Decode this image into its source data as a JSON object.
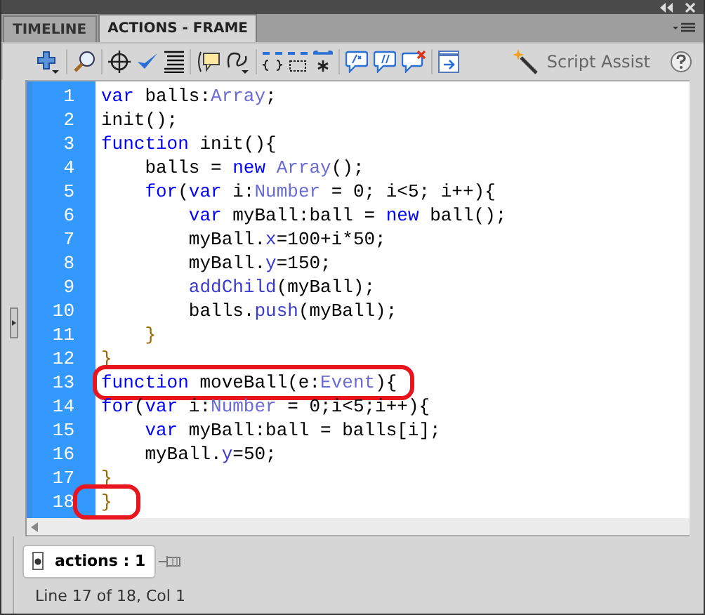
{
  "tabs": [
    {
      "label": "TIMELINE",
      "selected": false
    },
    {
      "label": "ACTIONS - FRAME",
      "selected": true
    }
  ],
  "toolbar": {
    "script_assist": "Script Assist"
  },
  "code": [
    {
      "n": "1",
      "tokens": [
        {
          "kind": "kw",
          "text": "var"
        },
        {
          "kind": "plain",
          "text": " balls:"
        },
        {
          "kind": "cls",
          "text": "Array"
        },
        {
          "kind": "plain",
          "text": ";"
        }
      ],
      "highlighted": false
    },
    {
      "n": "2",
      "tokens": [
        {
          "kind": "plain",
          "text": "init();"
        }
      ],
      "highlighted": false
    },
    {
      "n": "3",
      "tokens": [
        {
          "kind": "kw",
          "text": "function"
        },
        {
          "kind": "plain",
          "text": " init(){"
        }
      ],
      "highlighted": false
    },
    {
      "n": "4",
      "tokens": [
        {
          "kind": "plain",
          "text": "    balls = "
        },
        {
          "kind": "kw",
          "text": "new "
        },
        {
          "kind": "cls",
          "text": "Array"
        },
        {
          "kind": "plain",
          "text": "();"
        }
      ],
      "highlighted": false
    },
    {
      "n": "5",
      "tokens": [
        {
          "kind": "kw",
          "text": "    for"
        },
        {
          "kind": "plain",
          "text": "("
        },
        {
          "kind": "kw",
          "text": "var"
        },
        {
          "kind": "plain",
          "text": " i:"
        },
        {
          "kind": "cls",
          "text": "Number"
        },
        {
          "kind": "plain",
          "text": " = 0; i<5; i++){"
        }
      ],
      "highlighted": false
    },
    {
      "n": "6",
      "tokens": [
        {
          "kind": "kw",
          "text": "        var"
        },
        {
          "kind": "plain",
          "text": " myBall:ball = "
        },
        {
          "kind": "kw",
          "text": "new"
        },
        {
          "kind": "plain",
          "text": " ball();"
        }
      ],
      "highlighted": false
    },
    {
      "n": "7",
      "tokens": [
        {
          "kind": "plain",
          "text": "        myBall."
        },
        {
          "kind": "prop",
          "text": "x"
        },
        {
          "kind": "plain",
          "text": "=100+i*50;"
        }
      ],
      "highlighted": false
    },
    {
      "n": "8",
      "tokens": [
        {
          "kind": "plain",
          "text": "        myBall."
        },
        {
          "kind": "prop",
          "text": "y"
        },
        {
          "kind": "plain",
          "text": "=150;"
        }
      ],
      "highlighted": false
    },
    {
      "n": "9",
      "tokens": [
        {
          "kind": "prop",
          "text": "        addChild"
        },
        {
          "kind": "plain",
          "text": "(myBall);"
        }
      ],
      "highlighted": false
    },
    {
      "n": "10",
      "tokens": [
        {
          "kind": "plain",
          "text": "        balls."
        },
        {
          "kind": "prop",
          "text": "push"
        },
        {
          "kind": "plain",
          "text": "(myBall);"
        }
      ],
      "highlighted": false
    },
    {
      "n": "11",
      "tokens": [
        {
          "kind": "brace",
          "text": "    }"
        }
      ],
      "highlighted": false
    },
    {
      "n": "12",
      "tokens": [
        {
          "kind": "brace",
          "text": "}"
        }
      ],
      "highlighted": false
    },
    {
      "n": "13",
      "tokens": [
        {
          "kind": "kw",
          "text": "function"
        },
        {
          "kind": "plain",
          "text": " moveBall(e:"
        },
        {
          "kind": "cls",
          "text": "Event"
        },
        {
          "kind": "plain",
          "text": "){"
        }
      ],
      "highlighted": true
    },
    {
      "n": "14",
      "tokens": [
        {
          "kind": "kw",
          "text": "for"
        },
        {
          "kind": "plain",
          "text": "("
        },
        {
          "kind": "kw",
          "text": "var"
        },
        {
          "kind": "plain",
          "text": " i:"
        },
        {
          "kind": "cls",
          "text": "Number"
        },
        {
          "kind": "plain",
          "text": " = 0;i<5;i++){"
        }
      ],
      "highlighted": false
    },
    {
      "n": "15",
      "tokens": [
        {
          "kind": "kw",
          "text": "    var"
        },
        {
          "kind": "plain",
          "text": " myBall:ball = balls[i];"
        }
      ],
      "highlighted": false
    },
    {
      "n": "16",
      "tokens": [
        {
          "kind": "plain",
          "text": "    myBall."
        },
        {
          "kind": "prop",
          "text": "y"
        },
        {
          "kind": "plain",
          "text": "=50;"
        }
      ],
      "highlighted": false
    },
    {
      "n": "17",
      "tokens": [
        {
          "kind": "brace",
          "text": "}"
        }
      ],
      "highlighted": false
    },
    {
      "n": "18",
      "tokens": [
        {
          "kind": "brace",
          "text": "}"
        }
      ],
      "highlighted": true
    }
  ],
  "script_tab": {
    "label": "actions : 1"
  },
  "status_bar": "Line 17 of 18, Col 1"
}
